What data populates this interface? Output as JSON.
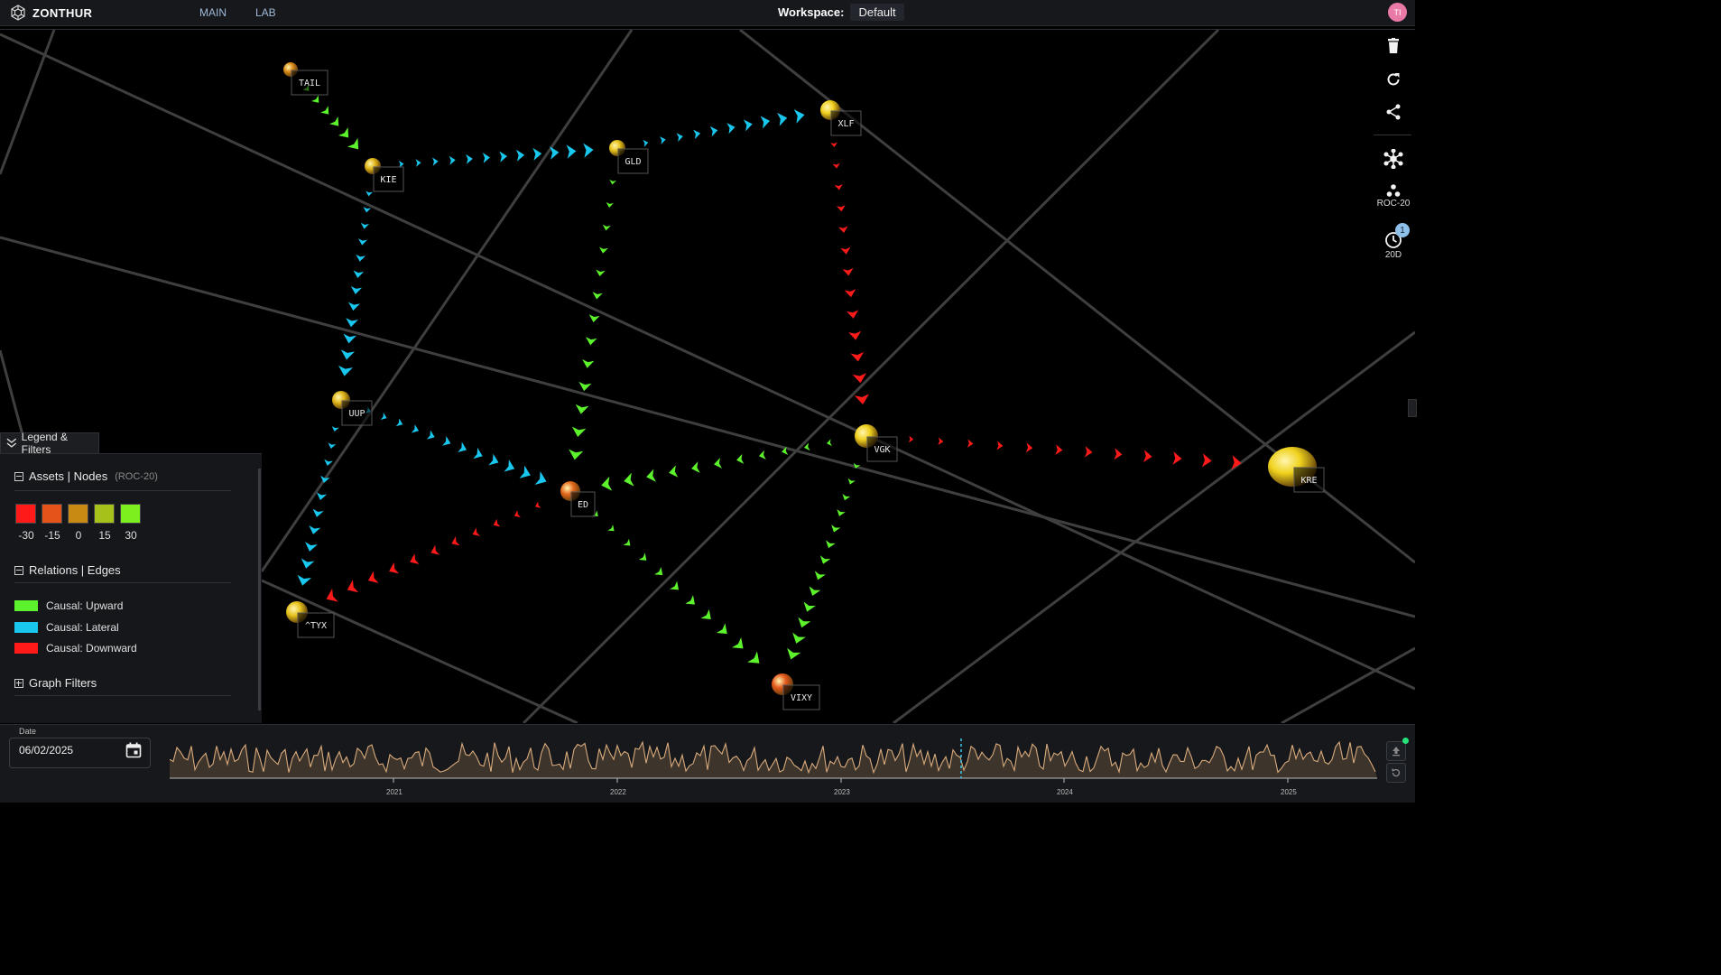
{
  "app": {
    "name": "ZONTHUR",
    "logo_icon": "hexagon-network-icon"
  },
  "nav": {
    "main": "MAIN",
    "lab": "LAB"
  },
  "workspace": {
    "label": "Workspace:",
    "value": "Default"
  },
  "user": {
    "initials": "TI",
    "avatar_color": "#e97aa8"
  },
  "toolbar": {
    "delete_icon": "trash-icon",
    "refresh_icon": "refresh-icon",
    "share_icon": "share-icon",
    "layout_icon": "network-layout-icon",
    "metric_icon": "node-cluster-icon",
    "metric_label": "ROC-20",
    "history_icon": "clock-history-icon",
    "history_label": "20D",
    "history_badge": "1"
  },
  "graph": {
    "nodes": [
      {
        "id": "TAIL",
        "label": "TAIL",
        "color": "#d98a18",
        "size": "small"
      },
      {
        "id": "KIE",
        "label": "KIE",
        "color": "#e0b418",
        "size": "small"
      },
      {
        "id": "GLD",
        "label": "GLD",
        "color": "#e6c21c",
        "size": "small"
      },
      {
        "id": "XLF",
        "label": "XLF",
        "color": "#efcf1e",
        "size": "medium"
      },
      {
        "id": "UUP",
        "label": "UUP",
        "color": "#e0b418",
        "size": "small"
      },
      {
        "id": "VGK",
        "label": "VGK",
        "color": "#efcf1e",
        "size": "medium"
      },
      {
        "id": "KRE",
        "label": "KRE",
        "color": "#f0d21e",
        "size": "large"
      },
      {
        "id": "ED",
        "label": "ED",
        "color": "#e3681c",
        "size": "small"
      },
      {
        "id": "TYX",
        "label": "^TYX",
        "color": "#e6c21c",
        "size": "small"
      },
      {
        "id": "VIXY",
        "label": "VIXY",
        "color": "#e4581c",
        "size": "medium"
      }
    ],
    "edges": [
      {
        "from": "TAIL",
        "to": "KIE",
        "type": "upward"
      },
      {
        "from": "KIE",
        "to": "GLD",
        "type": "lateral"
      },
      {
        "from": "GLD",
        "to": "XLF",
        "type": "lateral"
      },
      {
        "from": "KIE",
        "to": "UUP",
        "type": "lateral"
      },
      {
        "from": "UUP",
        "to": "TYX",
        "type": "lateral"
      },
      {
        "from": "UUP",
        "to": "ED",
        "type": "lateral"
      },
      {
        "from": "GLD",
        "to": "ED",
        "type": "upward"
      },
      {
        "from": "XLF",
        "to": "VGK",
        "type": "downward"
      },
      {
        "from": "VGK",
        "to": "KRE",
        "type": "downward"
      },
      {
        "from": "VGK",
        "to": "ED",
        "type": "upward"
      },
      {
        "from": "ED",
        "to": "TYX",
        "type": "downward"
      },
      {
        "from": "ED",
        "to": "VIXY",
        "type": "upward"
      },
      {
        "from": "VGK",
        "to": "VIXY",
        "type": "upward"
      }
    ]
  },
  "legend": {
    "tab_label": "Legend & Filters",
    "assets": {
      "title": "Assets | Nodes",
      "subtitle": "(ROC-20)",
      "scale": [
        {
          "value": "-30",
          "color": "#ff1a1a"
        },
        {
          "value": "-15",
          "color": "#e5531a"
        },
        {
          "value": "0",
          "color": "#c98a14"
        },
        {
          "value": "15",
          "color": "#a6c21a"
        },
        {
          "value": "30",
          "color": "#7bf01e"
        }
      ]
    },
    "relations": {
      "title": "Relations | Edges",
      "items": [
        {
          "label": "Causal: Upward",
          "color": "#5cf22c"
        },
        {
          "label": "Causal: Lateral",
          "color": "#19c7ee"
        },
        {
          "label": "Causal: Downward",
          "color": "#ff1a1a"
        }
      ]
    },
    "filters": {
      "title": "Graph Filters"
    }
  },
  "timeline": {
    "date_label": "Date",
    "date_value": "06/02/2025",
    "years": [
      "2021",
      "2022",
      "2023",
      "2024",
      "2025"
    ],
    "marker_color": "#3ac8f0"
  },
  "colors": {
    "upward": "#5cf22c",
    "lateral": "#19c7ee",
    "downward": "#ff1a1a",
    "background": "#000000",
    "panel": "#15171a"
  }
}
